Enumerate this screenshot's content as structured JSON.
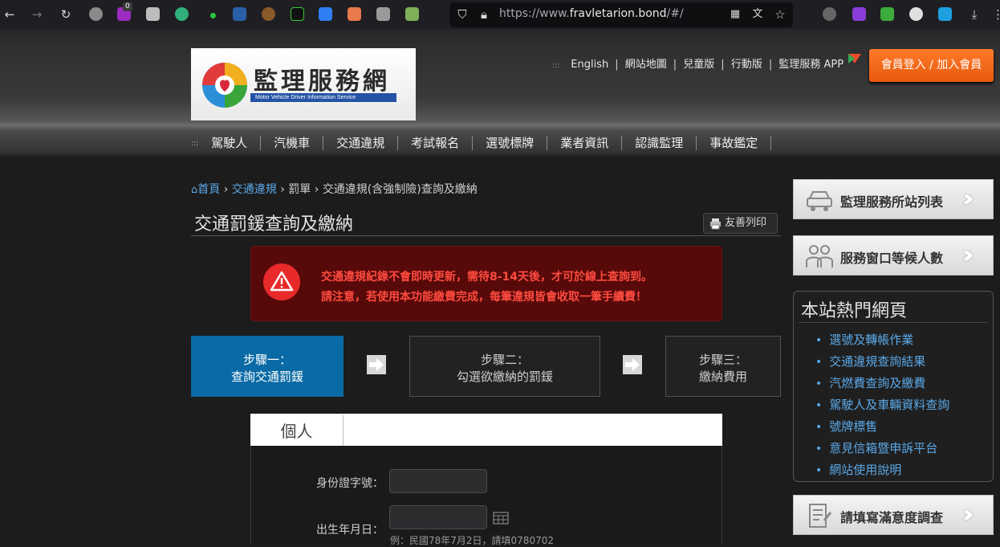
{
  "browser": {
    "url_prefix": "https://www.",
    "url_domain": "fravletarion.bond",
    "url_suffix": "/#/",
    "ext_badge": "0"
  },
  "header": {
    "logo_title": "監理服務網",
    "logo_subtitle": "Motor Vehicle Driver Information Service",
    "toplinks": [
      "English",
      "網站地圖",
      "兒童版",
      "行動版",
      "監理服務 APP"
    ],
    "toplinks_marker": ":::",
    "login_label": "會員登入 / 加入會員",
    "nav_marker": ":::",
    "nav": [
      "駕駛人",
      "汽機車",
      "交通違規",
      "考試報名",
      "選號標牌",
      "業者資訊",
      "認識監理",
      "事故鑑定"
    ]
  },
  "breadcrumb": {
    "home": "首頁",
    "level1": "交通違規",
    "level2": "罰單",
    "current": "交通違規(含強制險)查詢及繳納",
    "sep": "›"
  },
  "page": {
    "title": "交通罰鍰查詢及繳納",
    "print_label": "友善列印"
  },
  "alert": {
    "line1": "交通違規紀錄不會即時更新，需待8-14天後，才可於線上查詢到。",
    "line2": "請注意，若使用本功能繳費完成，每筆違規皆會收取一筆手續費！"
  },
  "steps": [
    {
      "title": "步驟一：",
      "desc": "查詢交通罰鍰"
    },
    {
      "title": "步驟二：",
      "desc": "勾選欲繳納的罰鍰"
    },
    {
      "title": "步驟三：",
      "desc": "繳納費用"
    }
  ],
  "form": {
    "tab_label": "個人",
    "id_label": "身份證字號：",
    "id_value": "",
    "birth_label": "出生年月日：",
    "birth_value": "",
    "birth_hint": "例：民國78年7月2日，請填0780702"
  },
  "sidebar": {
    "btn1": "監理服務所站列表",
    "btn2": "服務窗口等候人數",
    "hot_title": "本站熱門網頁",
    "hot_links": [
      "選號及轉帳作業",
      "交通違規查詢結果",
      "汽燃費查詢及繳費",
      "駕駛人及車輛資料查詢",
      "號牌標售",
      "意見信箱暨申訴平台",
      "網站使用說明"
    ],
    "btn3": "請填寫滿意度調查"
  },
  "colors": {
    "accent": "#0a6aa5",
    "alert_bg": "#580909",
    "alert_text": "#ff4b3f",
    "login": "#f26a1b",
    "link": "#5aa8e8"
  }
}
